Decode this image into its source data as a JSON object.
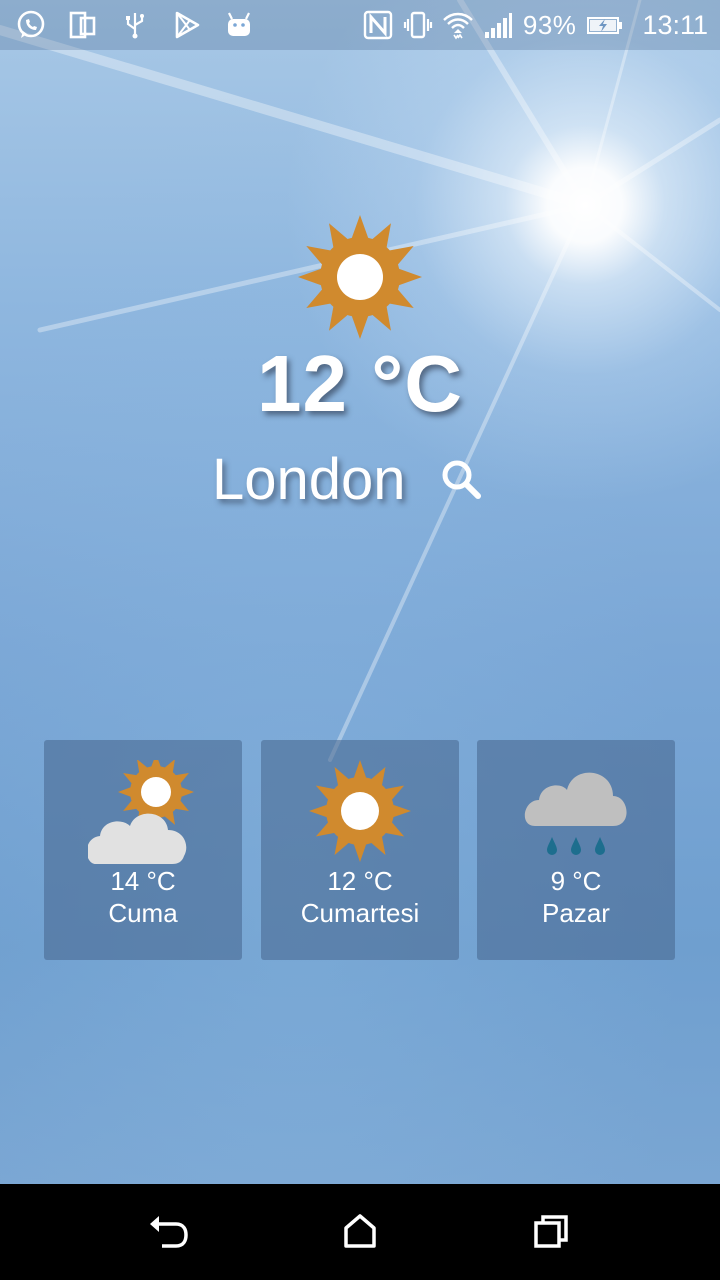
{
  "status_bar": {
    "battery_percent": "93%",
    "time": "13:11",
    "left_icons": [
      "whatsapp-icon",
      "dual-screen-icon",
      "usb-icon",
      "play-store-icon",
      "android-icon"
    ],
    "right_icons": [
      "nfc-icon",
      "vibrate-icon",
      "wifi-icon",
      "signal-icon",
      "battery-charging-icon"
    ]
  },
  "current": {
    "icon": "sun-icon",
    "temperature": "12 °C",
    "city": "London",
    "search_icon": "search-icon"
  },
  "forecast": [
    {
      "temp": "14  °C",
      "day": "Cuma",
      "icon": "partly-cloudy-icon"
    },
    {
      "temp": "12  °C",
      "day": "Cumartesi",
      "icon": "sun-icon"
    },
    {
      "temp": "9  °C",
      "day": "Pazar",
      "icon": "rain-icon"
    }
  ],
  "colors": {
    "sun": "#d08a2e",
    "cloud": "#e1e1e1",
    "rain_cloud": "#bfbfbf",
    "rain_drop": "#1d6e8e",
    "card_bg": "rgba(70,100,140,0.55)"
  },
  "nav_bar": [
    "back-icon",
    "home-icon",
    "recents-icon"
  ]
}
